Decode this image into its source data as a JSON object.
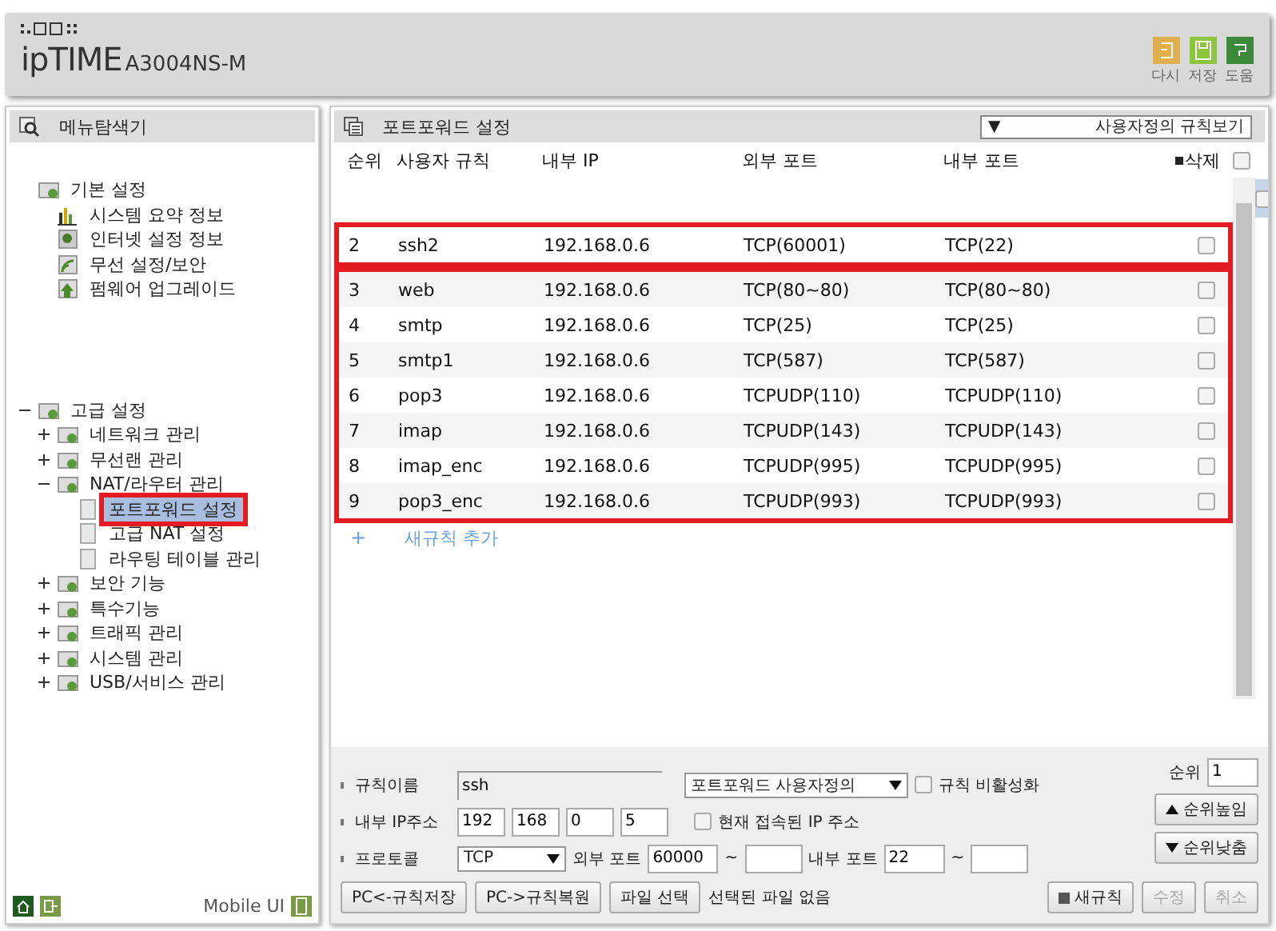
{
  "header": {
    "logo_text": "ipTIME",
    "model": "A3004NS-M",
    "actions": [
      {
        "label": "다시",
        "kind": "undo"
      },
      {
        "label": "저장",
        "kind": "save"
      },
      {
        "label": "도움",
        "kind": "help"
      }
    ]
  },
  "sidebar": {
    "title": "메뉴탐색기",
    "tree": [
      {
        "label": "기본 설정",
        "kind": "folder",
        "children": [
          {
            "label": "시스템 요약 정보",
            "kind": "chart"
          },
          {
            "label": "인터넷 설정 정보",
            "kind": "globe"
          },
          {
            "label": "무선 설정/보안",
            "kind": "wifi"
          },
          {
            "label": "펌웨어 업그레이드",
            "kind": "upgrade"
          }
        ]
      },
      {
        "label": "고급 설정",
        "kind": "folder",
        "expanded": true,
        "children": [
          {
            "label": "네트워크 관리",
            "kind": "folder",
            "expanded": false
          },
          {
            "label": "무선랜 관리",
            "kind": "folder",
            "expanded": false
          },
          {
            "label": "NAT/라우터 관리",
            "kind": "folder",
            "expanded": true,
            "children": [
              {
                "label": "포트포워드 설정",
                "kind": "page",
                "selected": true,
                "outlined": true
              },
              {
                "label": "고급 NAT 설정",
                "kind": "page",
                "selected": false
              },
              {
                "label": "라우팅 테이블 관리",
                "kind": "page",
                "selected": false
              }
            ]
          },
          {
            "label": "보안 기능",
            "kind": "folder",
            "expanded": false
          },
          {
            "label": "특수기능",
            "kind": "folder",
            "expanded": false
          },
          {
            "label": "트래픽 관리",
            "kind": "folder",
            "expanded": false
          },
          {
            "label": "시스템 관리",
            "kind": "folder",
            "expanded": false
          },
          {
            "label": "USB/서비스 관리",
            "kind": "folder",
            "expanded": false
          }
        ]
      }
    ],
    "footer": {
      "mobile_label": "Mobile UI"
    }
  },
  "panel": {
    "title": "포트포워드 설정",
    "view_select": {
      "arrow": "▼",
      "value": "사용자정의 규칙보기"
    },
    "table": {
      "columns": [
        "순위",
        "사용자 규칙",
        "내부 IP",
        "외부 포트",
        "내부 포트",
        "삭제"
      ],
      "select_all": false,
      "row_groups": [
        {
          "outlined": false,
          "rows": [
            {
              "kind": "blank",
              "checked": false
            }
          ]
        },
        {
          "outlined": true,
          "rows": [
            {
              "kind": "rule",
              "cells": [
                "2",
                "ssh2",
                "192.168.0.6",
                "TCP(60001)",
                "TCP(22)"
              ],
              "checked": false
            }
          ]
        },
        {
          "outlined": true,
          "rows": [
            {
              "kind": "rule",
              "cells": [
                "3",
                "web",
                "192.168.0.6",
                "TCP(80~80)",
                "TCP(80~80)"
              ],
              "checked": false
            },
            {
              "kind": "rule",
              "cells": [
                "4",
                "smtp",
                "192.168.0.6",
                "TCP(25)",
                "TCP(25)"
              ],
              "checked": false
            },
            {
              "kind": "rule",
              "cells": [
                "5",
                "smtp1",
                "192.168.0.6",
                "TCP(587)",
                "TCP(587)"
              ],
              "checked": false
            },
            {
              "kind": "rule",
              "cells": [
                "6",
                "pop3",
                "192.168.0.6",
                "TCPUDP(110)",
                "TCPUDP(110)"
              ],
              "checked": false
            },
            {
              "kind": "rule",
              "cells": [
                "7",
                "imap",
                "192.168.0.6",
                "TCPUDP(143)",
                "TCPUDP(143)"
              ],
              "checked": false
            },
            {
              "kind": "rule",
              "cells": [
                "8",
                "imap_enc",
                "192.168.0.6",
                "TCPUDP(995)",
                "TCPUDP(995)"
              ],
              "checked": false
            },
            {
              "kind": "rule",
              "cells": [
                "9",
                "pop3_enc",
                "192.168.0.6",
                "TCPUDP(993)",
                "TCPUDP(993)"
              ],
              "checked": false
            }
          ]
        }
      ],
      "add_rule": {
        "plus": "+",
        "label": "새규칙 추가"
      }
    },
    "form": {
      "name_label": "규칙이름",
      "name_value": "ssh",
      "type_select": "포트포워드 사용자정의",
      "disable_label": "규칙 비활성화",
      "disable_checked": false,
      "ip_label": "내부 IP주소",
      "ip": [
        "192",
        "168",
        "0",
        "5"
      ],
      "current_ip_label": "현재 접속된 IP 주소",
      "current_ip_checked": false,
      "protocol_label": "프로토콜",
      "protocol": "TCP",
      "ext_port_label": "외부 포트",
      "ext_port_from": "60000",
      "tilde": "~",
      "int_port_label": "내부 포트",
      "int_port_from": "22",
      "order_label": "순위",
      "order_value": "1",
      "up_label": "순위높임",
      "down_label": "순위낮춤"
    },
    "buttons": [
      {
        "label": "PC<-규칙저장",
        "disabled": false
      },
      {
        "label": "PC->규칙복원",
        "disabled": false
      },
      {
        "label": "파일 선택",
        "disabled": false
      }
    ],
    "file_status": "선택된 파일 없음",
    "right_buttons": [
      {
        "label": "새규칙",
        "disabled": false,
        "kind": "new"
      },
      {
        "label": "수정",
        "disabled": true
      },
      {
        "label": "취소",
        "disabled": true
      }
    ]
  }
}
